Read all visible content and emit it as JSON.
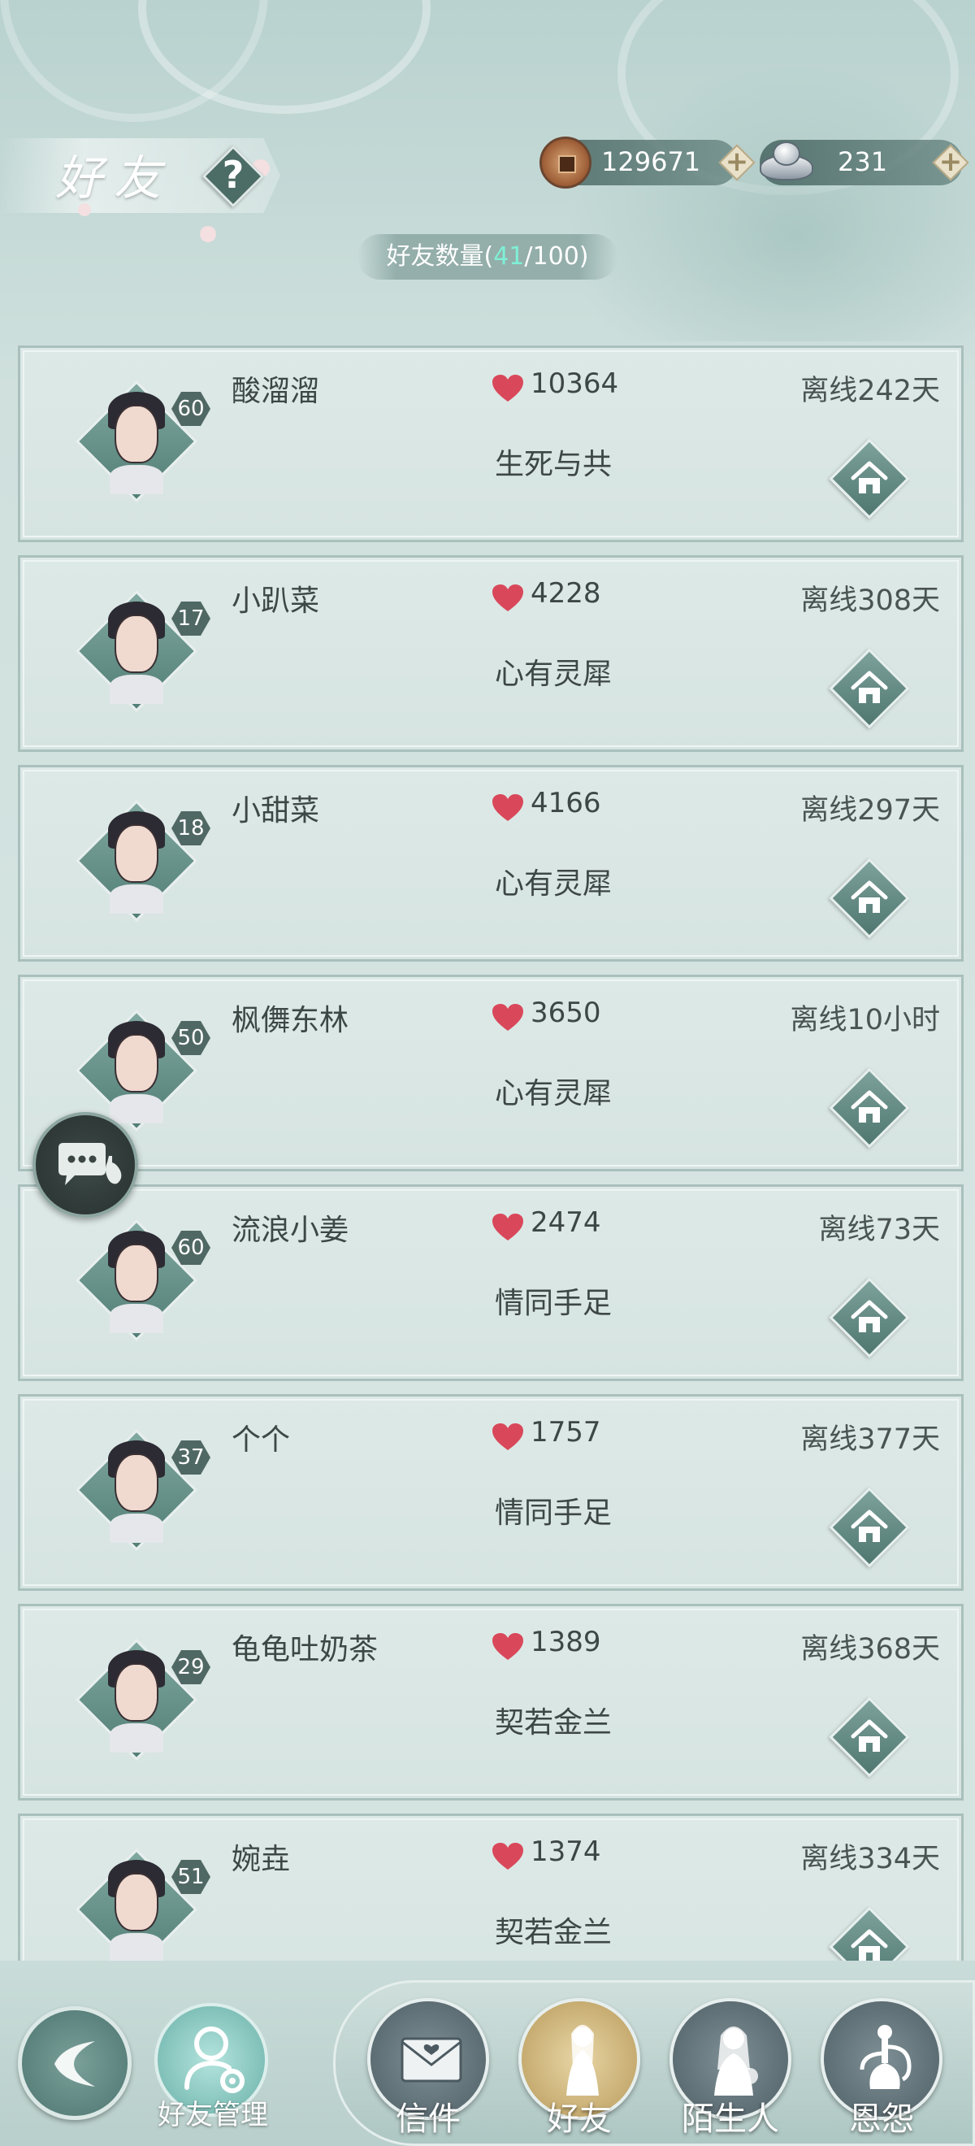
{
  "header": {
    "title": "好友",
    "help_label": "?",
    "copper_amount": "129671",
    "silver_amount": "231",
    "plus_label": "+",
    "count_prefix": "好友数量(",
    "count_current": "41",
    "count_separator": "/100)"
  },
  "friends": [
    {
      "name": "酸溜溜",
      "level": "60",
      "intimacy": "10364",
      "relation": "生死与共",
      "status": "离线242天"
    },
    {
      "name": "小趴菜",
      "level": "17",
      "intimacy": "4228",
      "relation": "心有灵犀",
      "status": "离线308天"
    },
    {
      "name": "小甜菜",
      "level": "18",
      "intimacy": "4166",
      "relation": "心有灵犀",
      "status": "离线297天"
    },
    {
      "name": "枫儛东林",
      "level": "50",
      "intimacy": "3650",
      "relation": "心有灵犀",
      "status": "离线10小时"
    },
    {
      "name": "流浪小姜",
      "level": "60",
      "intimacy": "2474",
      "relation": "情同手足",
      "status": "离线73天"
    },
    {
      "name": "个个",
      "level": "37",
      "intimacy": "1757",
      "relation": "情同手足",
      "status": "离线377天"
    },
    {
      "name": "龟龟吐奶茶",
      "level": "29",
      "intimacy": "1389",
      "relation": "契若金兰",
      "status": "离线368天"
    },
    {
      "name": "婉垚",
      "level": "51",
      "intimacy": "1374",
      "relation": "契若金兰",
      "status": "离线334天"
    }
  ],
  "bottom_nav": {
    "manage_label": "好友管理",
    "tabs": [
      {
        "label": "信件",
        "icon": "envelope-icon",
        "active": false
      },
      {
        "label": "好友",
        "icon": "female-figure-icon",
        "active": true
      },
      {
        "label": "陌生人",
        "icon": "stranger-figure-icon",
        "active": false
      },
      {
        "label": "恩怨",
        "icon": "hookah-icon",
        "active": false
      }
    ]
  },
  "colors": {
    "accent_count": "#7ff0d6",
    "heart": "#d9485a",
    "active_tab": "#c9ad6e"
  }
}
